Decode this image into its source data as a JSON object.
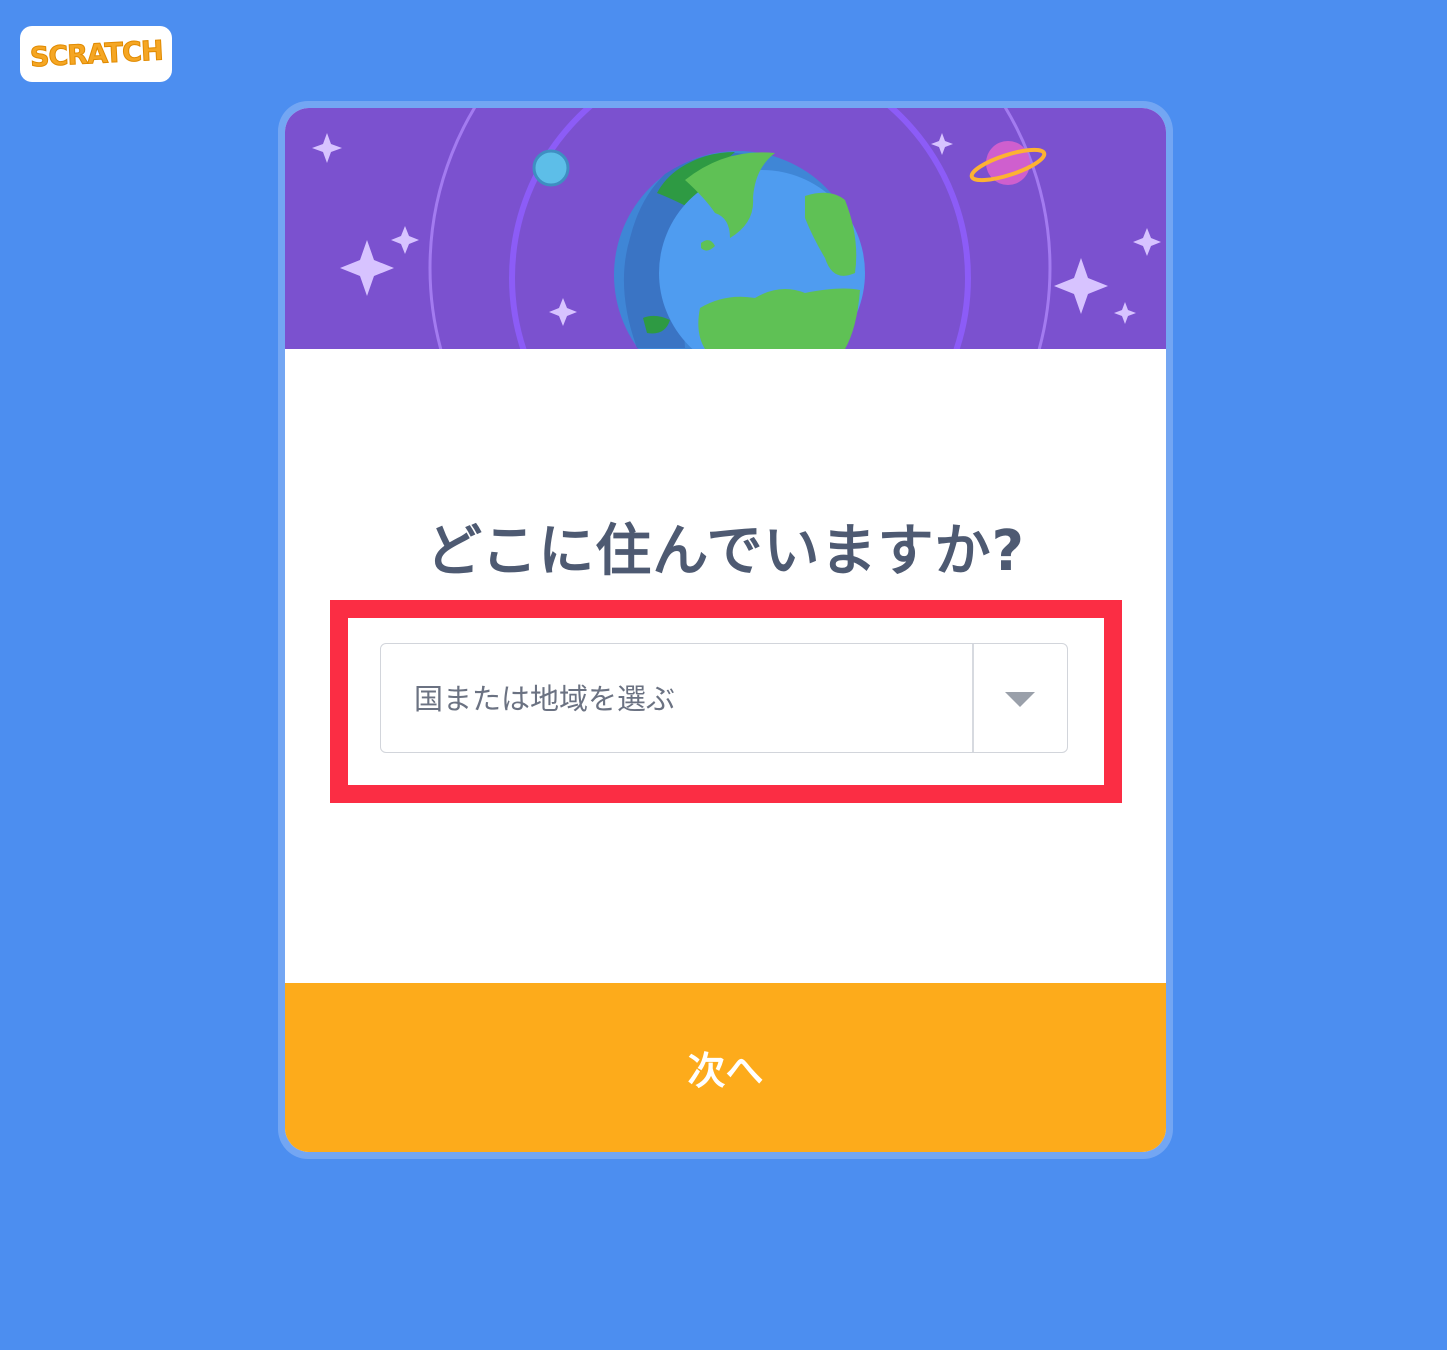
{
  "logo": {
    "text": "SCRATCH"
  },
  "dialog": {
    "question": "どこに住んでいますか?",
    "country_select": {
      "placeholder": "国または地域を選ぶ",
      "arrow_icon": "caret-down-icon"
    },
    "next_label": "次へ"
  },
  "colors": {
    "page_background": "#4c8ef0",
    "banner": "#7b51cf",
    "next_button": "#fdab1b",
    "highlight": "#fb2d44",
    "question_text": "#4e5a72"
  }
}
